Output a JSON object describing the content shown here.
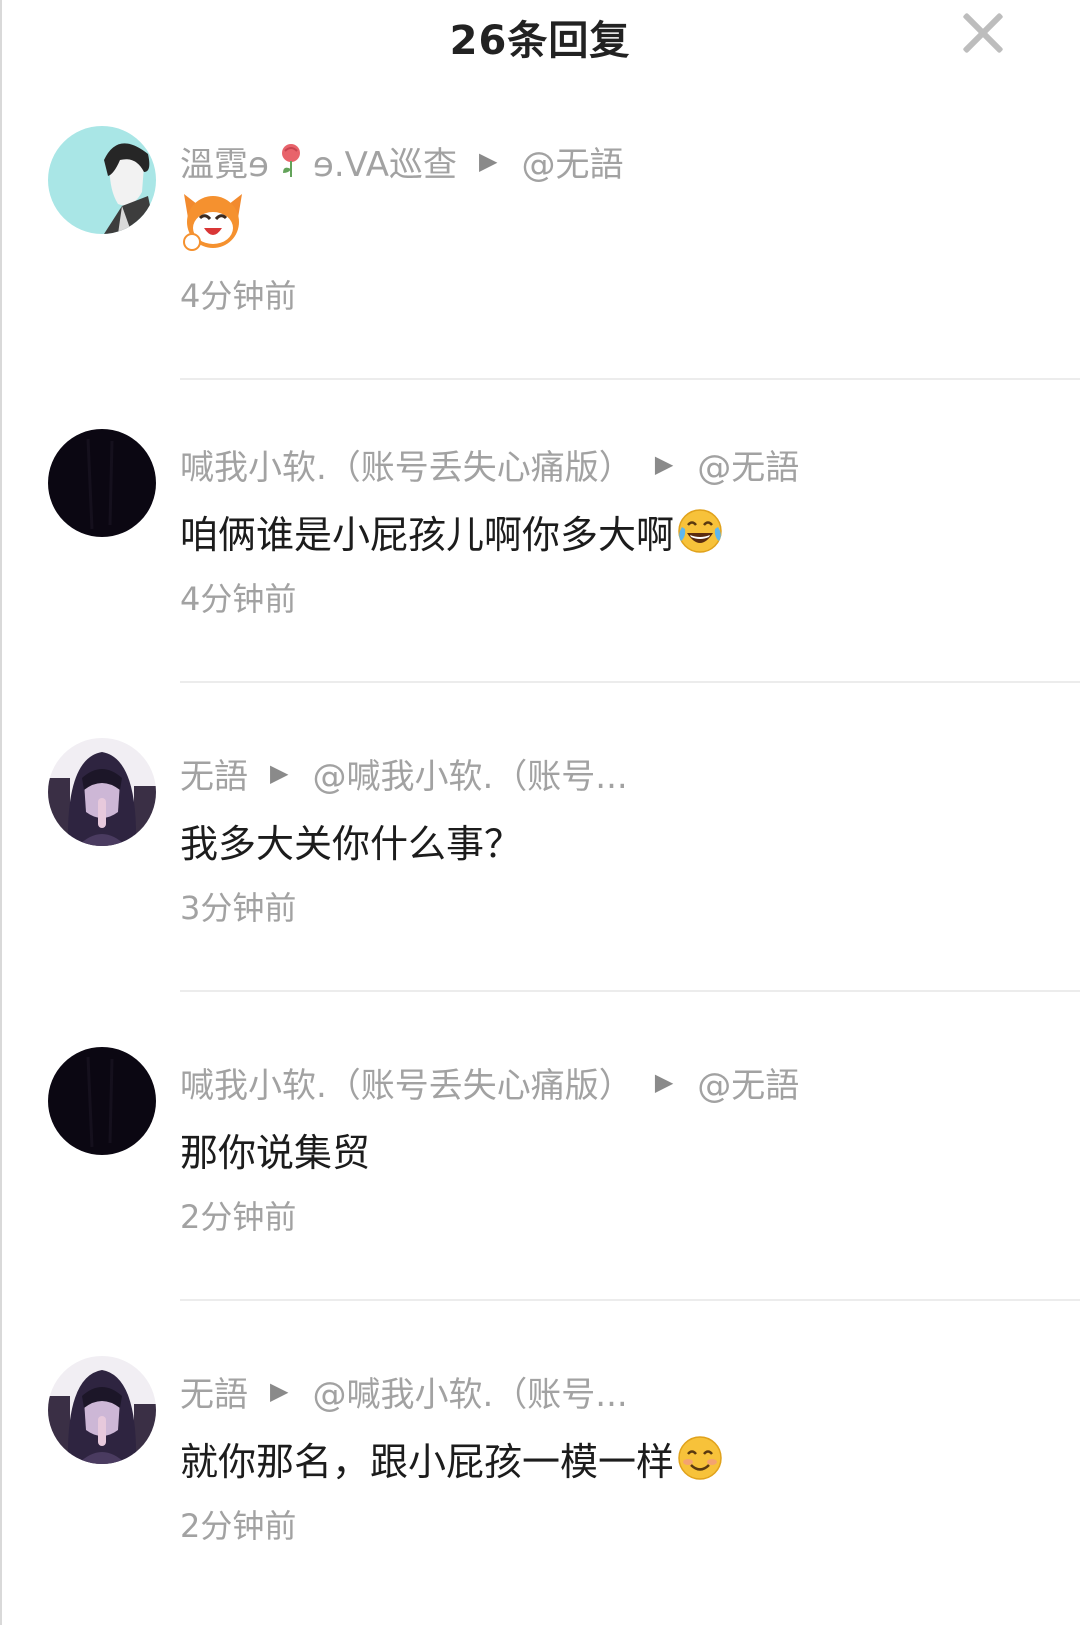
{
  "header": {
    "title": "26条回复",
    "close_icon": "close-icon"
  },
  "comments": [
    {
      "author": "溫霓ɘ",
      "author_suffix": "ɘ.VA巡查",
      "author_decoration": "rose-icon",
      "reply_to": "@无語",
      "content": "",
      "sticker": "laughing-cartoon-sticker",
      "time": "4分钟前"
    },
    {
      "author": "喊我小软.（账号丢失心痛版）",
      "reply_to": "@无語",
      "content": "咱俩谁是小屁孩儿啊你多大啊",
      "emoji": "tears-of-joy-emoji",
      "time": "4分钟前"
    },
    {
      "author": "无語",
      "reply_to": "@喊我小软.（账号...",
      "content": "我多大关你什么事？",
      "time": "3分钟前"
    },
    {
      "author": "喊我小软.（账号丢失心痛版）",
      "reply_to": "@无語",
      "content": "那你说集贸",
      "time": "2分钟前"
    },
    {
      "author": "无語",
      "reply_to": "@喊我小软.（账号...",
      "content": "就你那名，跟小屁孩一模一样",
      "emoji": "smiling-face-emoji",
      "time": "2分钟前"
    }
  ],
  "colors": {
    "meta_text": "#a2a2a2",
    "content_text": "#1c1c1c",
    "divider": "#ececec",
    "close_icon": "#bdbdbd"
  }
}
